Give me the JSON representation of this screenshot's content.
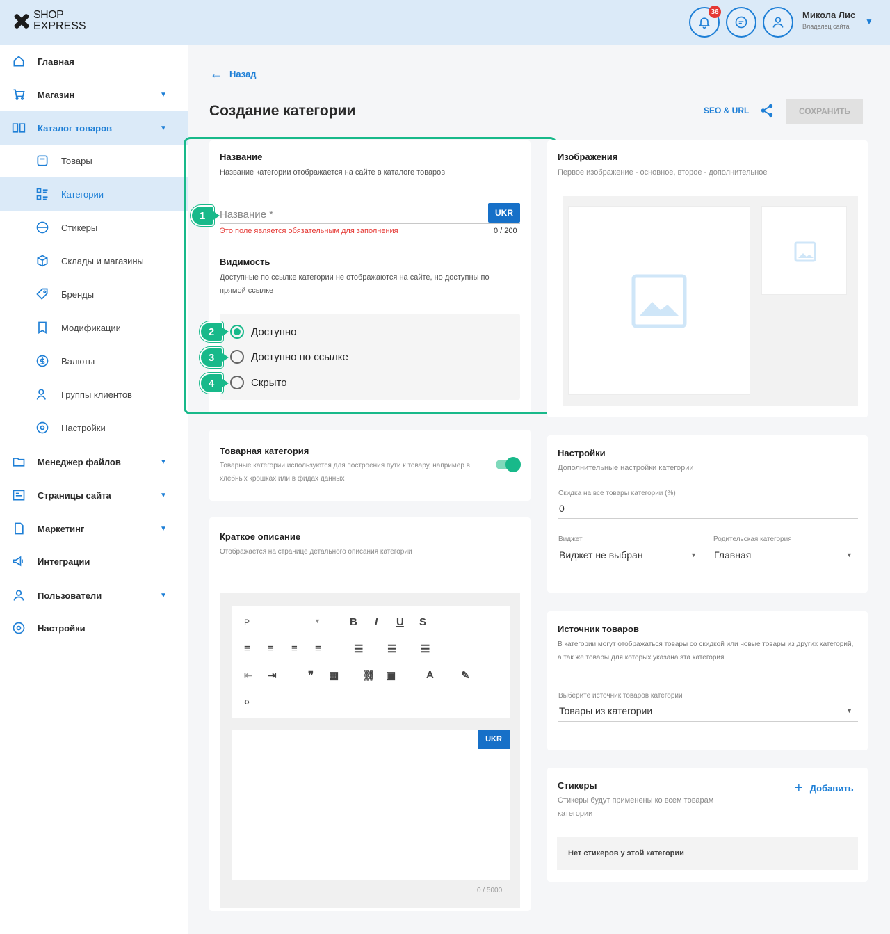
{
  "header": {
    "logo_line1": "SHOP",
    "logo_line2": "EXPRESS",
    "notifications_count": "36",
    "user_name": "Микола Лис",
    "user_role": "Владелец сайта"
  },
  "sidebar": {
    "items": [
      {
        "label": "Главная",
        "icon": "home-icon"
      },
      {
        "label": "Магазин",
        "icon": "cart-icon"
      },
      {
        "label": "Каталог товаров",
        "icon": "catalog-icon"
      },
      {
        "label": "Товары",
        "icon": "box-icon"
      },
      {
        "label": "Категории",
        "icon": "category-icon"
      },
      {
        "label": "Стикеры",
        "icon": "sticker-icon"
      },
      {
        "label": "Склады и магазины",
        "icon": "warehouse-icon"
      },
      {
        "label": "Бренды",
        "icon": "tag-icon"
      },
      {
        "label": "Модификации",
        "icon": "bookmark-icon"
      },
      {
        "label": "Валюты",
        "icon": "dollar-icon"
      },
      {
        "label": "Группы клиентов",
        "icon": "users-icon"
      },
      {
        "label": "Настройки",
        "icon": "gear-icon"
      },
      {
        "label": "Менеджер файлов",
        "icon": "folder-icon"
      },
      {
        "label": "Страницы сайта",
        "icon": "pages-icon"
      },
      {
        "label": "Маркетинг",
        "icon": "marketing-icon"
      },
      {
        "label": "Интеграции",
        "icon": "megaphone-icon"
      },
      {
        "label": "Пользователи",
        "icon": "user-icon"
      },
      {
        "label": "Настройки",
        "icon": "gear-icon"
      }
    ]
  },
  "main": {
    "back_label": "Назад",
    "page_title": "Создание категории",
    "seo_label": "SEO & URL",
    "save_label": "СОХРАНИТЬ"
  },
  "name_card": {
    "title": "Название",
    "description": "Название категории отображается на сайте в каталоге товаров",
    "placeholder": "Название *",
    "lang": "UKR",
    "error": "Это поле является обязательным для заполнения",
    "counter": "0 / 200",
    "visibility_title": "Видимость",
    "visibility_desc": "Доступные по ссылке категории не отображаются на сайте, но доступны по прямой ссылке",
    "options": [
      "Доступно",
      "Доступно по ссылке",
      "Скрыто"
    ],
    "selected": "Доступно",
    "steps": [
      "1",
      "2",
      "3",
      "4"
    ]
  },
  "images_card": {
    "title": "Изображения",
    "description": "Первое изображение - основное, второе - дополнительное"
  },
  "product_category_card": {
    "title": "Товарная категория",
    "description": "Товарные категории используются для построения пути к товару, например в хлебных крошках или в фидах данных",
    "enabled": true
  },
  "settings_card": {
    "title": "Настройки",
    "description": "Дополнительные настройки категории",
    "discount_label": "Скидка на все товары категории (%)",
    "discount_value": "0",
    "widget_label": "Виджет",
    "widget_value": "Виджет не выбран",
    "parent_label": "Родительская категория",
    "parent_value": "Главная"
  },
  "short_desc_card": {
    "title": "Краткое описание",
    "description": "Отображается на странице детального описания категории",
    "format": "P",
    "lang": "UKR",
    "counter": "0 / 5000"
  },
  "source_card": {
    "title": "Источник товаров",
    "description": "В категории могут отображаться товары со скидкой или новые товары из других категорий, а так же товары для которых указана эта категория",
    "select_label": "Выберите источник товаров категории",
    "select_value": "Товары из категории"
  },
  "stickers_card": {
    "title": "Стикеры",
    "description": "Стикеры будут применены ко всем товарам категории",
    "add_label": "Добавить",
    "empty": "Нет стикеров у этой категории"
  }
}
